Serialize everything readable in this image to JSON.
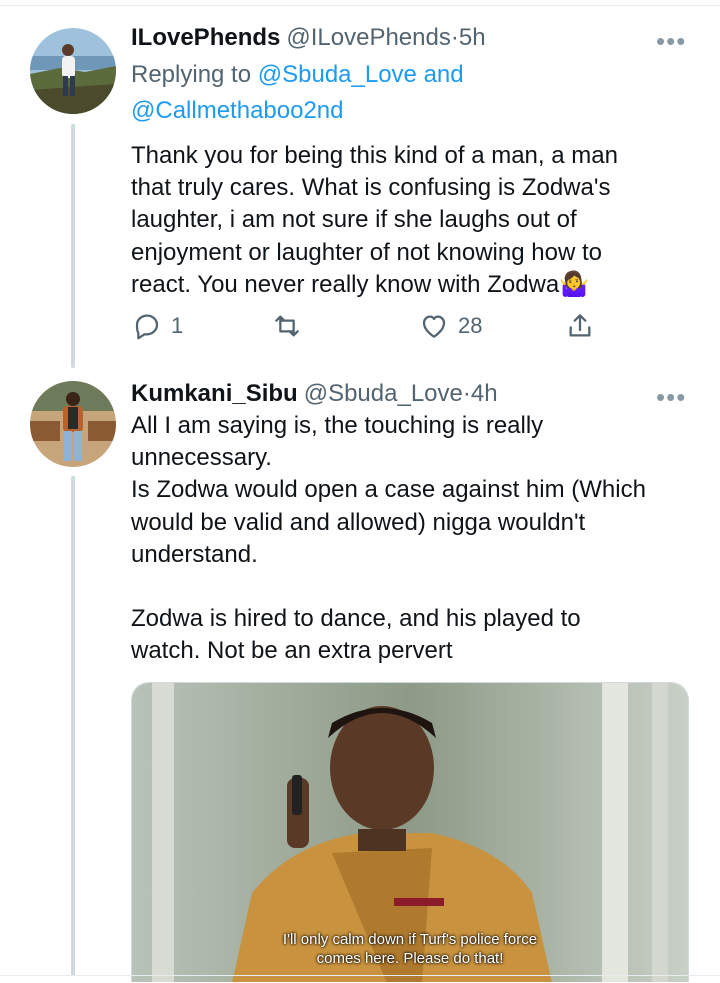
{
  "tweet1": {
    "display_name": "ILovePhends",
    "handle": "@ILovePhends",
    "separator": "·",
    "time": "5h",
    "replying_prefix": "Replying to",
    "mention_1": "@Sbuda_Love",
    "replying_and": "and",
    "mention_2": "@Callmethaboo2nd",
    "body_lines": [
      "Thank you for being this kind of a man, a man",
      "that truly cares. What is confusing is Zodwa's",
      "laughter, i am not sure if she laughs out of",
      "enjoyment or laughter of not knowing how to",
      "react. You never really know with Zodwa🤷‍♀️"
    ],
    "reply_count": "1",
    "retweet_count": "",
    "like_count": "28"
  },
  "tweet2": {
    "display_name": "Kumkani_Sibu",
    "handle": "@Sbuda_Love",
    "separator": "·",
    "time": "4h",
    "body_lines": [
      "All I am saying is, the touching is really",
      "unnecessary.",
      "Is Zodwa would open a case against him (Which",
      "would be valid and allowed) nigga wouldn't",
      "understand.",
      "",
      "Zodwa is hired to dance, and his played to",
      "watch. Not be an extra pervert"
    ],
    "media_caption_1": "I'll only calm down if Turf's police force",
    "media_caption_2": "comes here. Please do that!"
  },
  "icons": {
    "more": "more-dots-icon",
    "reply": "reply-bubble-icon",
    "retweet": "retweet-icon",
    "like": "heart-icon",
    "share": "share-icon"
  },
  "colors": {
    "link": "#1d9bf0",
    "secondary": "#536471",
    "thread_line": "#cfd9de"
  }
}
